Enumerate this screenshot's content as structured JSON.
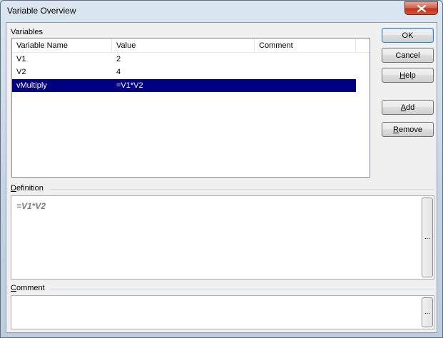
{
  "window": {
    "title": "Variable Overview"
  },
  "variables": {
    "group_label": "Variables",
    "columns": [
      "Variable Name",
      "Value",
      "Comment"
    ],
    "rows": [
      {
        "name": "V1",
        "value": "2",
        "comment": "",
        "selected": false
      },
      {
        "name": "V2",
        "value": "4",
        "comment": "",
        "selected": false
      },
      {
        "name": "vMultiply",
        "value": "=V1*V2",
        "comment": "",
        "selected": true
      }
    ]
  },
  "definition": {
    "label_accel": "D",
    "label_rest": "efinition",
    "value": "=V1*V2",
    "ellipsis": "..."
  },
  "comment": {
    "label_accel": "C",
    "label_rest": "omment",
    "value": "",
    "ellipsis": "..."
  },
  "buttons": {
    "ok": "OK",
    "cancel": "Cancel",
    "help_accel": "H",
    "help_rest": "elp",
    "add_accel": "A",
    "add_rest": "dd",
    "remove_accel": "R",
    "remove_rest": "emove"
  },
  "colors": {
    "selection": "#000080",
    "close_button": "#c2321a"
  },
  "icons": {
    "close": "close-icon"
  }
}
